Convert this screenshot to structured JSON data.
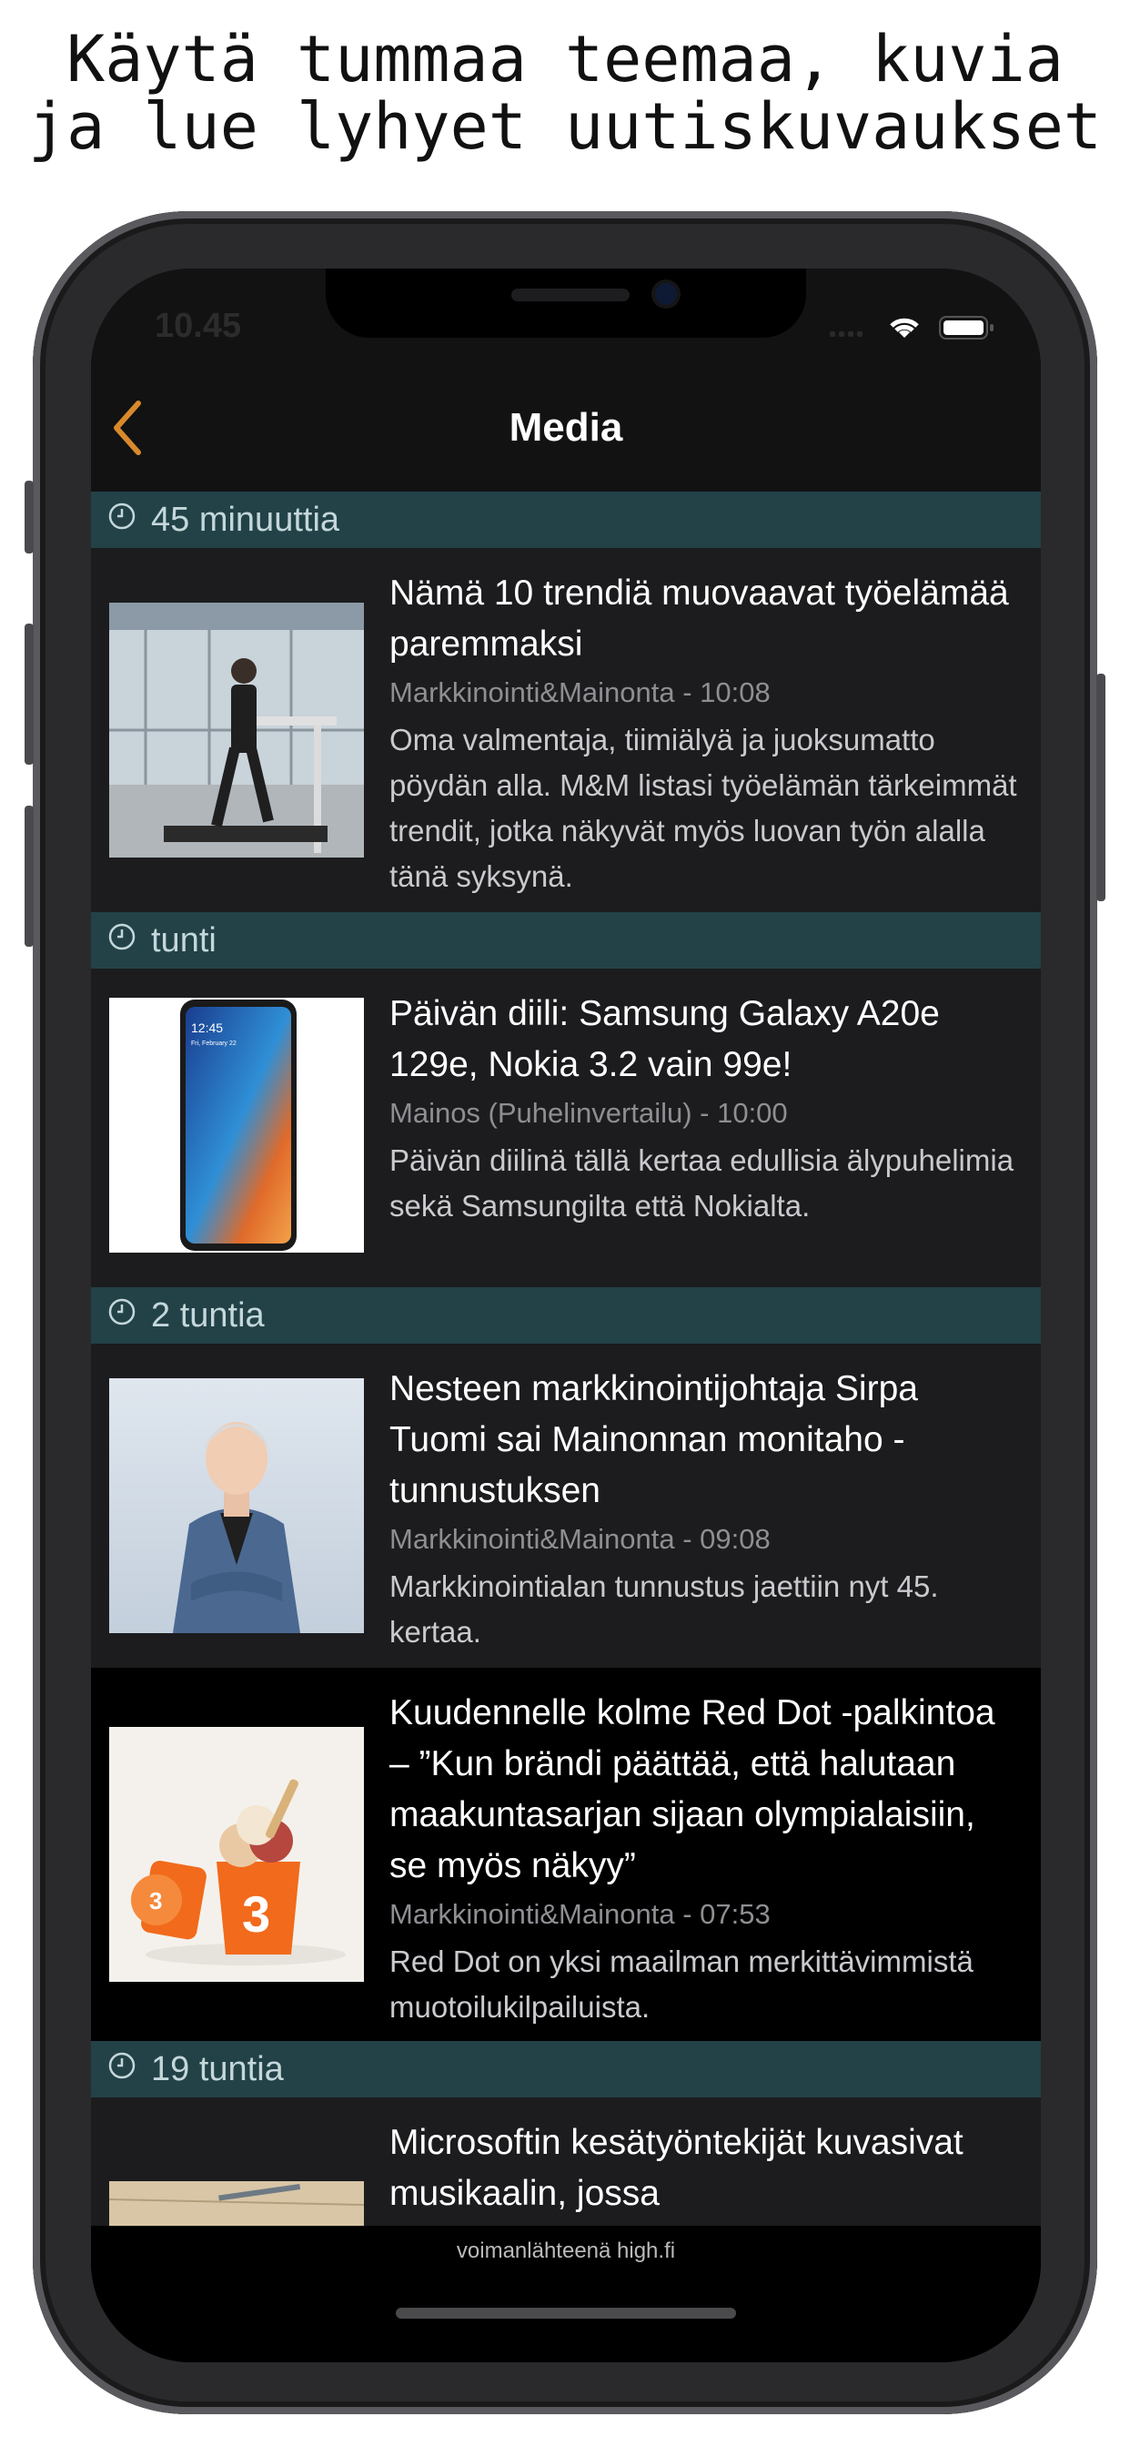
{
  "headline": [
    "Käytä tummaa teemaa, kuvia",
    "ja lue lyhyet uutiskuvaukset"
  ],
  "status": {
    "time": "10.45"
  },
  "nav": {
    "title": "Media"
  },
  "sections": [
    {
      "label": "45 minuuttia"
    },
    {
      "label": "tunti"
    },
    {
      "label": "2 tuntia"
    },
    {
      "label": "19 tuntia"
    }
  ],
  "articles": [
    {
      "title": "Nämä 10 trendiä muovaavat työelämää paremmaksi",
      "meta": "Markkinointi&Mainonta - 10:08",
      "desc": "Oma valmentaja, tiimiälyä ja juoksumatto pöydän alla. M&M listasi työelämän tärkeimmät trendit, jotka näkyvät myös luovan työn alalla tänä syksynä."
    },
    {
      "title": "Päivän diili: Samsung Galaxy A20e 129e, Nokia 3.2 vain 99e!",
      "meta": "Mainos (Puhelinvertailu) - 10:00",
      "desc": "Päivän diilinä tällä kertaa edullisia älypuhelimia sekä Samsungilta että Nokialta.",
      "image_text": {
        "time": "12:45",
        "date": "Fri, February 22"
      }
    },
    {
      "title": "Nesteen markkinointijohtaja Sirpa Tuomi sai Mainonnan monitaho -tunnustuksen",
      "meta": "Markkinointi&Mainonta - 09:08",
      "desc": "Markkinointialan tunnustus jaettiin nyt 45. kertaa."
    },
    {
      "title": "Kuudennelle kolme Red Dot -palkintoa – ”Kun brändi päättää, että halutaan maakuntasarjan sijaan olympialaisiin, se myös näkyy”",
      "meta": "Markkinointi&Mainonta - 07:53",
      "desc": "Red Dot on yksi maailman merkittävimmistä muotoilukilpailuista.",
      "image_text": "3"
    },
    {
      "title": "Microsoftin kesätyöntekijät kuvasivat musikaalin, jossa"
    }
  ],
  "footer": {
    "text": "voimanlähteenä high.fi"
  },
  "colors": {
    "section_bg": "#224248",
    "accent": "#d9892c",
    "article_bg": "#1c1c1e"
  },
  "icons": [
    "back-chevron-icon",
    "clock-icon",
    "wifi-icon",
    "battery-icon",
    "signal-icon"
  ]
}
